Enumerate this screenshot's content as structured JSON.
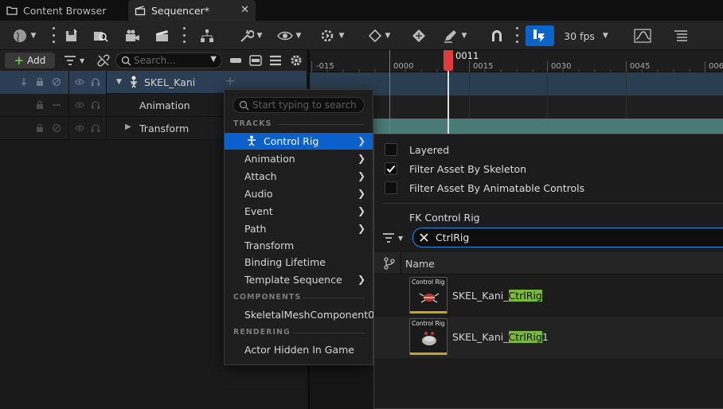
{
  "tabs": [
    {
      "label": "Content Browser",
      "icon": "folder-icon"
    },
    {
      "label": "Sequencer*",
      "icon": "clapper-icon"
    }
  ],
  "toolbar": {
    "fps_label": "30 fps"
  },
  "outliner": {
    "add_label": "Add",
    "search_placeholder": "Search...",
    "rows": [
      {
        "label": "SKEL_Kani"
      },
      {
        "label": "Animation"
      },
      {
        "label": "Transform"
      }
    ]
  },
  "timeline": {
    "current_frame": "0011",
    "tick_labels": [
      "-015",
      "0000",
      "0015",
      "0030",
      "0045",
      "006"
    ]
  },
  "context_menu": {
    "search_placeholder": "Start typing to search",
    "section_tracks": "TRACKS",
    "items": [
      {
        "label": "Control Rig",
        "submenu": true
      },
      {
        "label": "Animation",
        "submenu": true
      },
      {
        "label": "Attach",
        "submenu": true
      },
      {
        "label": "Audio",
        "submenu": true
      },
      {
        "label": "Event",
        "submenu": true
      },
      {
        "label": "Path",
        "submenu": true
      },
      {
        "label": "Transform",
        "submenu": false
      },
      {
        "label": "Binding Lifetime",
        "submenu": false
      },
      {
        "label": "Template Sequence",
        "submenu": true
      }
    ],
    "section_components": "COMPONENTS",
    "component_item": "SkeletalMeshComponent0",
    "section_rendering": "RENDERING",
    "rendering_item": "Actor Hidden In Game"
  },
  "submenu": {
    "options": [
      {
        "label": "Layered",
        "checked": false
      },
      {
        "label": "Filter Asset By Skeleton",
        "checked": true
      },
      {
        "label": "Filter Asset By Animatable Controls",
        "checked": false
      }
    ],
    "fk_label": "FK Control Rig",
    "filter_value": "CtrlRig",
    "name_header": "Name",
    "assets": [
      {
        "prefix": "SKEL_Kani_",
        "match": "CtrlRig",
        "suffix": "",
        "thumb_label": "Control Rig"
      },
      {
        "prefix": "SKEL_Kani_",
        "match": "CtrlRig",
        "suffix": "1",
        "thumb_label": "Control Rig"
      }
    ]
  },
  "colors": {
    "accent": "#0b60cc",
    "playhead": "#e03c3c",
    "match_highlight": "#7ab83a",
    "track_selected": "#2c3d54",
    "track_teal": "#4a7a76"
  }
}
